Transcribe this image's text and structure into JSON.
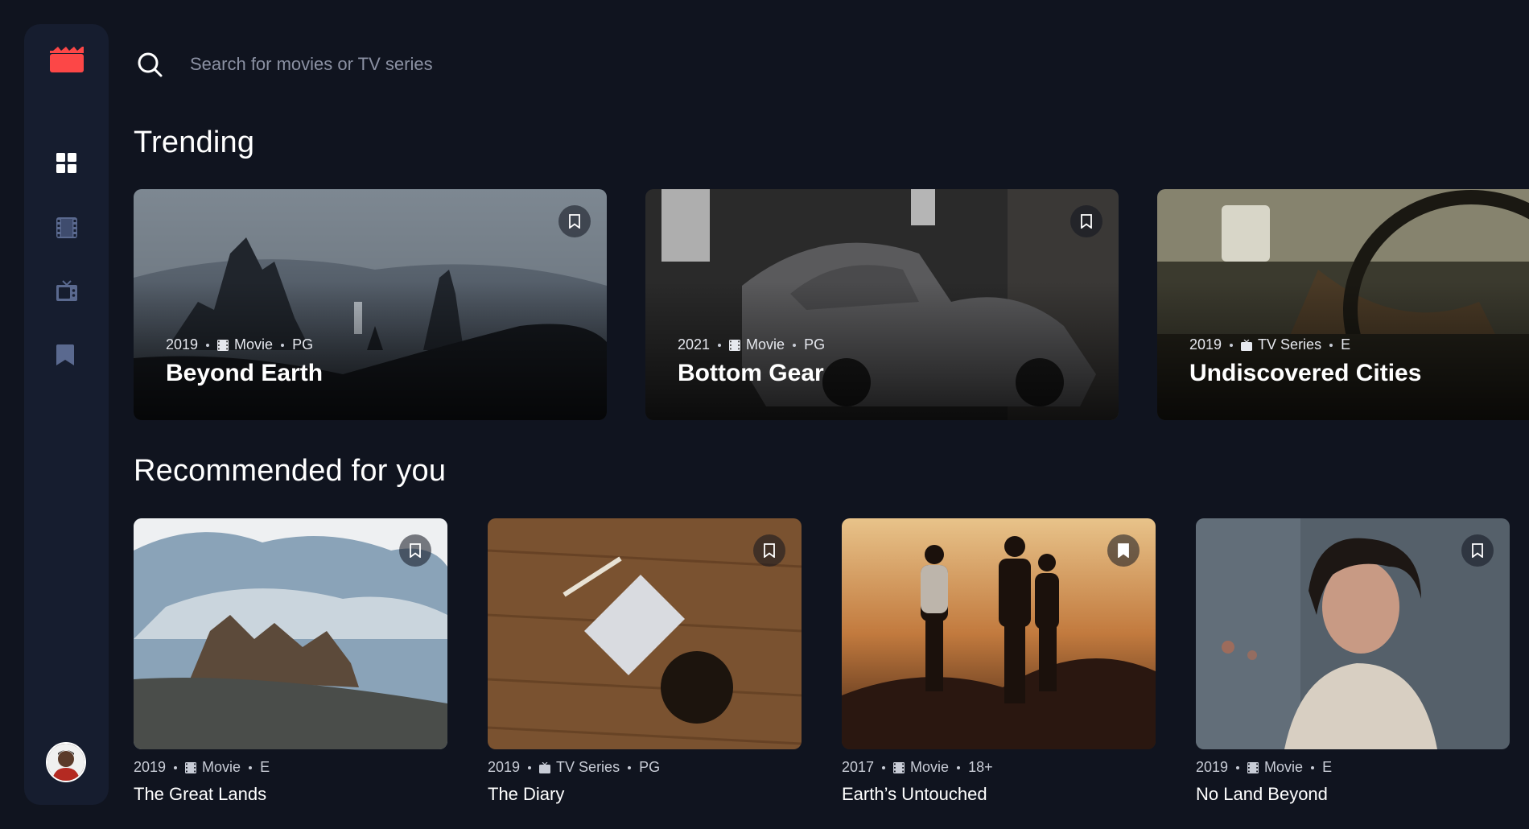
{
  "colors": {
    "background": "#10141f",
    "sidebar": "#161d2f",
    "accent": "#fc4747",
    "nav_icon": "#5a698f",
    "nav_icon_active": "#ffffff"
  },
  "sidebar": {
    "logo_icon": "clapperboard-icon",
    "nav": [
      {
        "icon": "grid-icon",
        "active": true
      },
      {
        "icon": "film-icon",
        "active": false
      },
      {
        "icon": "tv-icon",
        "active": false
      },
      {
        "icon": "bookmark-icon",
        "active": false
      }
    ],
    "avatar_icon": "avatar"
  },
  "search": {
    "placeholder": "Search for movies or TV series"
  },
  "trending": {
    "title": "Trending",
    "items": [
      {
        "year": "2019",
        "category": "Movie",
        "rating": "PG",
        "title": "Beyond Earth"
      },
      {
        "year": "2021",
        "category": "Movie",
        "rating": "PG",
        "title": "Bottom Gear"
      },
      {
        "year": "2019",
        "category": "TV Series",
        "rating": "E",
        "title": "Undiscovered Cities"
      }
    ]
  },
  "recommended": {
    "title": "Recommended for you",
    "items": [
      {
        "year": "2019",
        "category": "Movie",
        "rating": "E",
        "title": "The Great Lands"
      },
      {
        "year": "2019",
        "category": "TV Series",
        "rating": "PG",
        "title": "The Diary"
      },
      {
        "year": "2017",
        "category": "Movie",
        "rating": "18+",
        "title": "Earth’s Untouched"
      },
      {
        "year": "2019",
        "category": "Movie",
        "rating": "E",
        "title": "No Land Beyond"
      }
    ]
  }
}
